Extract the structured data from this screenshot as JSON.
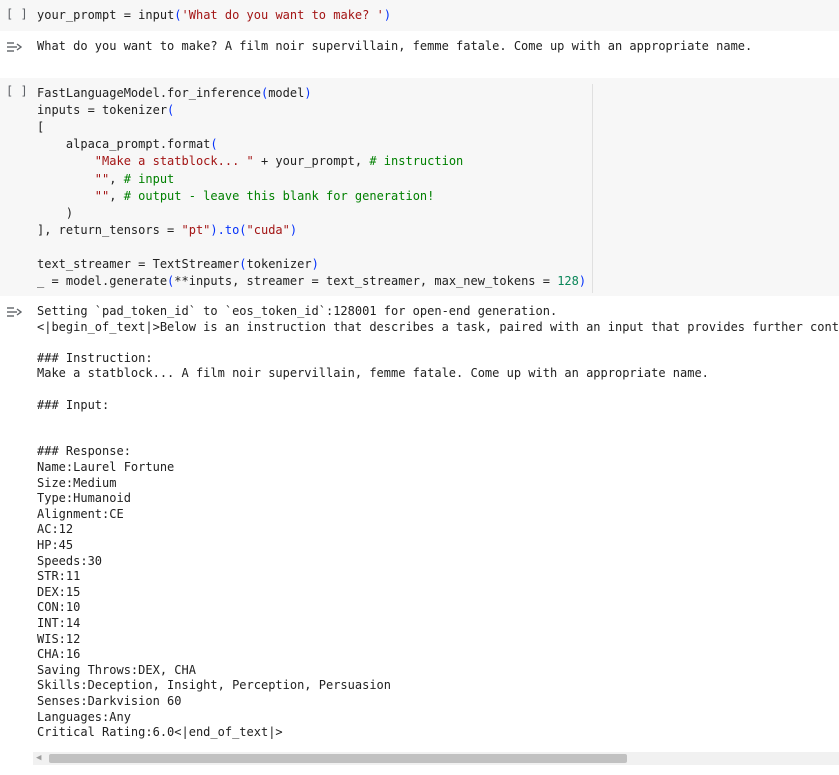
{
  "cell1": {
    "run_label": "[ ]",
    "code": {
      "var": "your_prompt",
      "eq": " = ",
      "fn": "input",
      "open": "(",
      "str": "'What do you want to make? '",
      "close": ")"
    },
    "output": "What do you want to make? A film noir supervillain, femme fatale. Come up with an appropriate name."
  },
  "cell2": {
    "run_label": "[ ]",
    "lines": [
      {
        "a": "FastLanguageModel.for_inference",
        "b": "(",
        "c": "model",
        "d": ")"
      },
      {
        "a": "inputs = tokenizer",
        "b": "("
      },
      {
        "a": "["
      },
      {
        "a": "    alpaca_prompt.format",
        "b": "("
      },
      {
        "s": "        \"Make a statblock... \"",
        "a": " + your_prompt, ",
        "c": "# instruction"
      },
      {
        "s": "        \"\"",
        "a": ", ",
        "c": "# input"
      },
      {
        "s": "        \"\"",
        "a": ", ",
        "c": "# output - leave this blank for generation!"
      },
      {
        "a": "    )"
      },
      {
        "a": "], return_tensors = ",
        "s": "\"pt\"",
        "b": ").to(",
        "s2": "\"cuda\"",
        "d": ")"
      },
      {
        "a": ""
      },
      {
        "a": "text_streamer = TextStreamer",
        "b": "(",
        "c": "tokenizer",
        "d": ")"
      },
      {
        "a": "_ = model.generate",
        "b": "(",
        "c": "**inputs, streamer = text_streamer, max_new_tokens = ",
        "n": "128",
        "d": ")"
      }
    ],
    "output": [
      "Setting `pad_token_id` to `eos_token_id`:128001 for open-end generation.",
      "<|begin_of_text|>Below is an instruction that describes a task, paired with an input that provides further context.",
      "",
      "### Instruction:",
      "Make a statblock... A film noir supervillain, femme fatale. Come up with an appropriate name.",
      "",
      "### Input:",
      "",
      "",
      "### Response:",
      "Name:Laurel Fortune",
      "Size:Medium",
      "Type:Humanoid",
      "Alignment:CE",
      "AC:12",
      "HP:45",
      "Speeds:30",
      "STR:11",
      "DEX:15",
      "CON:10",
      "INT:14",
      "WIS:12",
      "CHA:16",
      "Saving Throws:DEX, CHA",
      "Skills:Deception, Insight, Perception, Persuasion",
      "Senses:Darkvision 60",
      "Languages:Any",
      "Critical Rating:6.0<|end_of_text|>"
    ]
  },
  "icons": {
    "output_toggle": "output-toggle-icon",
    "scroll_left": "scroll-left-arrow-icon"
  },
  "colors": {
    "code_bg": "#f7f7f7",
    "string": "#a31515",
    "comment": "#008000",
    "number": "#098658",
    "paren": "#0431fa"
  }
}
